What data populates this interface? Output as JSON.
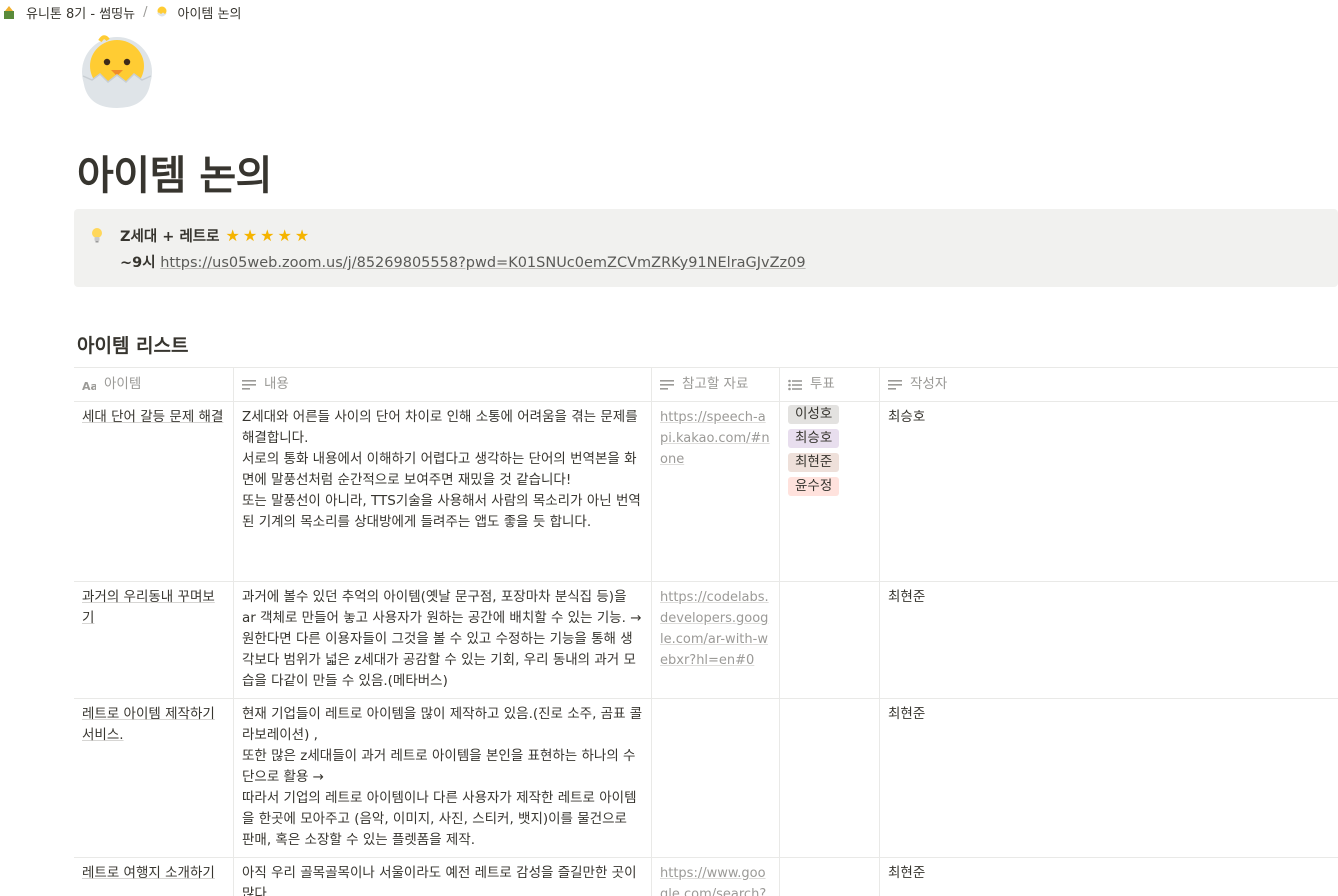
{
  "breadcrumb": {
    "workspace": "유니톤 8기 - 썸띵뉴",
    "separator": "/",
    "page": "아이템 논의"
  },
  "page": {
    "icon": "hatching-chick-icon",
    "title": "아이템 논의"
  },
  "callout": {
    "icon": "light-bulb-icon",
    "line1": "Z세대 + 레트로",
    "stars_count": 5,
    "line2_prefix": "~9시",
    "link": "https://us05web.zoom.us/j/85269805558?pwd=K01SNUc0emZCVmZRKy91NElraGJvZz09"
  },
  "database": {
    "title": "아이템 리스트",
    "columns": [
      {
        "label": "아이템",
        "icon": "title-aa-icon"
      },
      {
        "label": "내용",
        "icon": "text-lines-icon"
      },
      {
        "label": "참고할 자료",
        "icon": "text-lines-icon"
      },
      {
        "label": "투표",
        "icon": "multi-select-list-icon"
      },
      {
        "label": "작성자",
        "icon": "text-lines-icon"
      }
    ],
    "rows": [
      {
        "item": "세대 단어 갈등 문제 해결",
        "content": [
          "Z세대와 어른들 사이의 단어 차이로 인해 소통에 어려움을 겪는 문제를 해결합니다.",
          "서로의 통화 내용에서 이해하기 어렵다고 생각하는 단어의 번역본을 화면에 말풍선처럼 순간적으로 보여주면 재밌을 것 같습니다!",
          "또는 말풍선이 아니라, TTS기술을 사용해서 사람의 목소리가 아닌 번역된 기계의 목소리를 상대방에게 들려주는 앱도 좋을 듯 합니다."
        ],
        "reference": "https://speech-api.kakao.com/#none",
        "votes": [
          "이성호",
          "최승호",
          "최현준",
          "윤수정"
        ],
        "author": "최승호"
      },
      {
        "item": "과거의 우리동내 꾸며보기",
        "content": [
          "과거에 볼수 있던 추억의 아이템(옛날 문구점, 포장마차 분식집 등)을 ar 객체로 만들어 놓고 사용자가 원하는 공간에 배치할 수 있는 기능. → 원한다면 다른 이용자들이 그것을 볼 수 있고 수정하는 기능을 통해 생각보다 범위가 넓은 z세대가 공감할 수 있는 기회, 우리 동내의 과거 모습을 다같이 만들 수 있음.(메타버스)"
        ],
        "reference": "https://codelabs.developers.google.com/ar-with-webxr?hl=en#0",
        "votes": [],
        "author": "최현준"
      },
      {
        "item": "레트로 아이템 제작하기 서비스.",
        "content": [
          "현재 기업들이 레트로 아이템을 많이 제작하고 있음.(진로 소주, 곰표 콜라보레이션) ,",
          "또한 많은 z세대들이 과거 레트로 아이템을 본인을 표현하는 하나의 수단으로 활용 →",
          "따라서 기업의 레트로 아이템이나 다른 사용자가 제작한 레트로 아이템을 한곳에 모아주고 (음악, 이미지, 사진, 스티커, 뱃지)이를 물건으로 판매, 혹은 소장할 수 있는 플렛폼을 제작."
        ],
        "reference": "",
        "votes": [],
        "author": "최현준"
      },
      {
        "item": "레트로 여행지 소개하기",
        "content": [
          "아직 우리 골목골목이나 서울이라도 예전 레트로 감성을 즐길만한 곳이 많다."
        ],
        "reference": "https://www.google.com/search?",
        "votes": [],
        "author": "최현준"
      }
    ],
    "tag_colors": {
      "이성호": "#e3e2e0",
      "최승호": "#e8deee",
      "최현준": "#eee0da",
      "윤수정": "#ffe2dd"
    }
  }
}
